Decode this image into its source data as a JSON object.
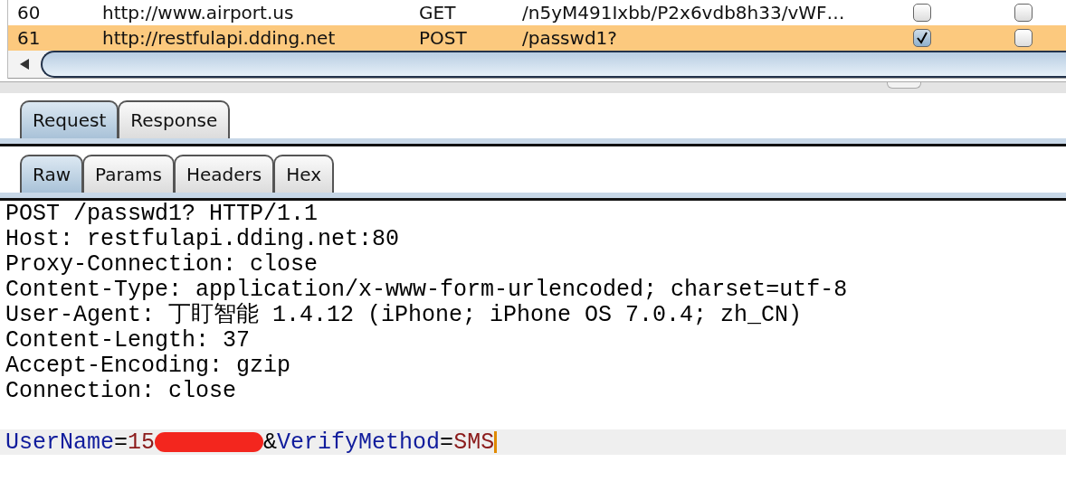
{
  "table": {
    "rows": [
      {
        "number": "60",
        "host": "http://www.airport.us",
        "method": "GET",
        "url": "/n5yM491Ixbb/P2x6vdb8h33/vWF…",
        "check_1": false,
        "check_2": false,
        "selected": false
      },
      {
        "number": "61",
        "host": "http://restfulapi.dding.net",
        "method": "POST",
        "url": "/passwd1?",
        "check_1": true,
        "check_2": false,
        "selected": true
      }
    ]
  },
  "message_tabs": [
    {
      "label": "Request",
      "selected": true
    },
    {
      "label": "Response",
      "selected": false
    }
  ],
  "view_tabs": [
    {
      "label": "Raw",
      "selected": true
    },
    {
      "label": "Params",
      "selected": false
    },
    {
      "label": "Headers",
      "selected": false
    },
    {
      "label": "Hex",
      "selected": false
    }
  ],
  "request_lines": [
    "POST /passwd1? HTTP/1.1",
    "Host: restfulapi.dding.net:80",
    "Proxy-Connection: close",
    "Content-Type: application/x-www-form-urlencoded; charset=utf-8",
    "User-Agent: 丁盯智能 1.4.12 (iPhone; iPhone OS 7.0.4; zh_CN)",
    "Content-Length: 37",
    "Accept-Encoding: gzip",
    "Connection: close"
  ],
  "body_tokens": [
    {
      "kind": "key",
      "text": "UserName"
    },
    {
      "kind": "op",
      "text": "="
    },
    {
      "kind": "value",
      "text": "15"
    },
    {
      "kind": "redaction"
    },
    {
      "kind": "op",
      "text": "&"
    },
    {
      "kind": "key",
      "text": "VerifyMethod"
    },
    {
      "kind": "op",
      "text": "="
    },
    {
      "kind": "value",
      "text": "SMS"
    }
  ]
}
